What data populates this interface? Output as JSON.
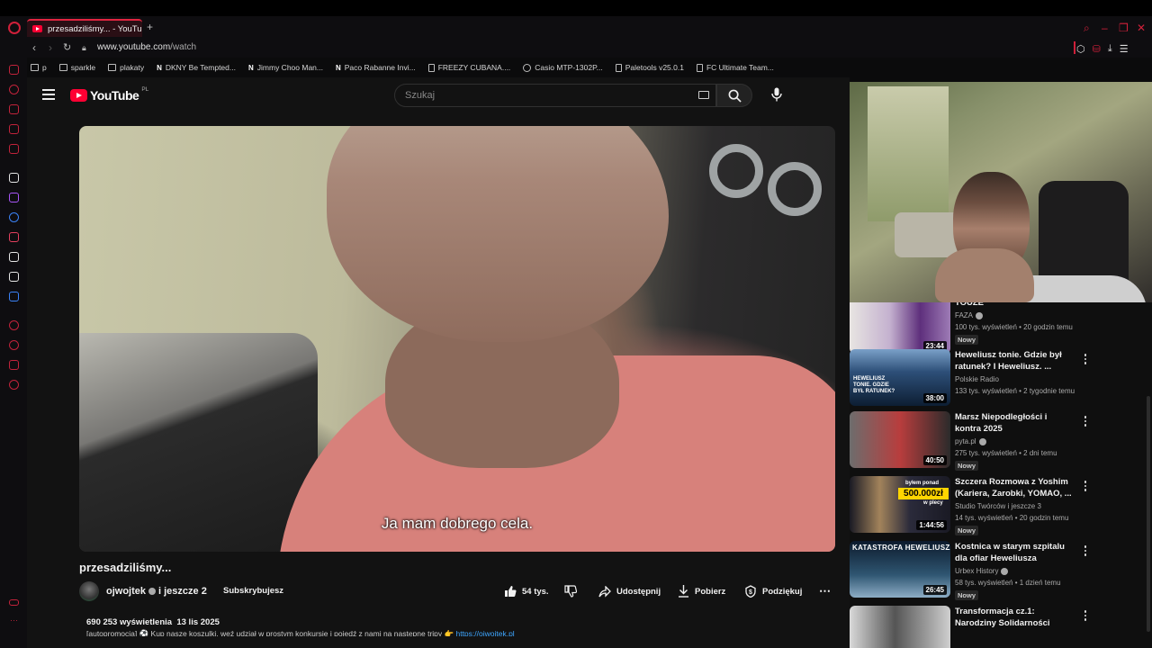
{
  "browser": {
    "tab_title": "przesadziliśmy... - YouTube",
    "url_host": "www.youtube.com",
    "url_path": "/watch",
    "new_tab": "+",
    "bookmarks": [
      {
        "label": "p",
        "icon": "folder-icon"
      },
      {
        "label": "sparkle",
        "icon": "folder-icon"
      },
      {
        "label": "plakaty",
        "icon": "folder-icon"
      },
      {
        "label": "DKNY Be Tempted...",
        "icon": "n-icon"
      },
      {
        "label": "Jimmy Choo Man...",
        "icon": "n-icon"
      },
      {
        "label": "Paco Rabanne Invi...",
        "icon": "n-icon"
      },
      {
        "label": "FREEZY CUBANA....",
        "icon": "page-icon"
      },
      {
        "label": "Casio MTP-1302P...",
        "icon": "clock-icon"
      },
      {
        "label": "Paletools v25.0.1",
        "icon": "page-icon"
      },
      {
        "label": "FC Ultimate Team...",
        "icon": "page-icon"
      }
    ]
  },
  "youtube": {
    "logo_text": "YouTube",
    "country": "PL",
    "search_placeholder": "Szukaj"
  },
  "video": {
    "subtitle": "Ja mam dobrego cela.",
    "title": "przesadziliśmy...",
    "channel": "ojwojtek",
    "channel_extra": "i jeszcze 2",
    "subscribe": "Subskrybujesz",
    "likes": "54 tys.",
    "share": "Udostępnij",
    "download": "Pobierz",
    "thanks": "Podziękuj",
    "views": "690 253 wyświetlenia",
    "date": "13 lis 2025",
    "description": "[autopromocja] ⚽ Kup nasze koszulki, weź udział w prostym konkursie i pojedź z nami na następne tripy 👉",
    "description_link": "https://ojwojtek.pl"
  },
  "recommendations": [
    {
      "title": "TOUZE",
      "channel": "FAZA",
      "verified": true,
      "meta": "100 tys. wyświetleń • 20 godzin temu",
      "badge": "Nowy",
      "duration": "23:44"
    },
    {
      "title": "Heweliusz tonie. Gdzie był ratunek? I Heweliusz. ...",
      "channel": "Polskie Radio",
      "verified": false,
      "meta": "133 tys. wyświetleń • 2 tygodnie temu",
      "badge": "",
      "duration": "38:00",
      "thumb_text": "HEWELIUSZ TONIE. GDZIE BYŁ RATUNEK?"
    },
    {
      "title": "Marsz Niepodległości i kontra 2025",
      "channel": "pyta.pl",
      "verified": true,
      "meta": "275 tys. wyświetleń • 2 dni temu",
      "badge": "Nowy",
      "duration": "40:50"
    },
    {
      "title": "Szczera Rozmowa z Yoshim (Kariera, Zarobki, YOMAO, ...",
      "channel": "Studio Twórców i jeszcze 3",
      "verified": false,
      "meta": "14 tys. wyświetleń • 20 godzin temu",
      "badge": "Nowy",
      "duration": "1:44:56",
      "thumb_top": "byłem ponad",
      "thumb_amount": "500.000zł",
      "thumb_bottom": "w plecy"
    },
    {
      "title": "Kostnica w starym szpitalu dla ofiar Heweliusza",
      "channel": "Urbex History",
      "verified": true,
      "meta": "58 tys. wyświetleń • 1 dzień temu",
      "badge": "Nowy",
      "duration": "26:45",
      "thumb_text": "KATASTROFA HEWELIUSZA"
    },
    {
      "title": "Transformacja cz.1: Narodziny Solidarności",
      "channel": "",
      "verified": false,
      "meta": "",
      "badge": "",
      "duration": ""
    }
  ]
}
